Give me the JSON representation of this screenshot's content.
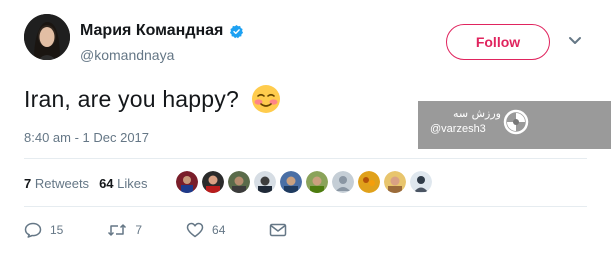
{
  "user": {
    "display_name": "Мария Командная",
    "handle": "@komandnaya",
    "verified_icon": "verified-badge-icon"
  },
  "header": {
    "follow_label": "Follow",
    "menu_icon": "chevron-down-icon"
  },
  "tweet": {
    "text": "Iran, are you happy?",
    "emoji": "blushing-face-emoji",
    "timestamp": "8:40 am - 1 Dec 2017"
  },
  "stats": {
    "retweets_count": "7",
    "retweets_label": "Retweets",
    "likes_count": "64",
    "likes_label": "Likes"
  },
  "actions": {
    "reply_count": "15",
    "retweet_count": "7",
    "like_count": "64"
  },
  "watermark": {
    "arabic": "ورزش سه",
    "handle": "@varzesh3"
  },
  "colors": {
    "follow": "#e0245e",
    "muted": "#657786",
    "verified": "#1da1f2"
  }
}
